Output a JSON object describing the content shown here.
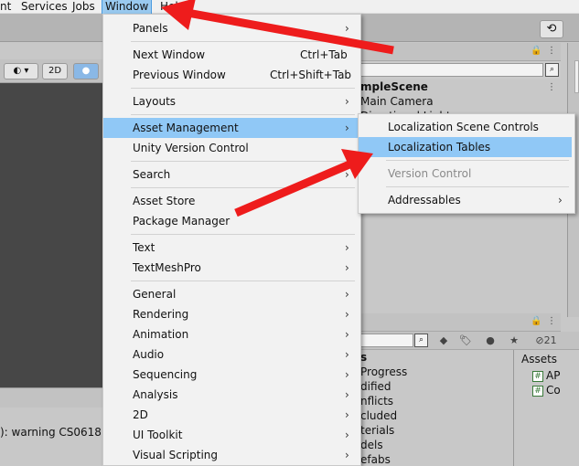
{
  "menubar": {
    "items": [
      "nt",
      "Services",
      "Jobs",
      "Window",
      "Help"
    ]
  },
  "toolbar": {
    "history_icon": "history-icon",
    "scene_buttons": {
      "mode": "2D"
    }
  },
  "hierarchy": {
    "title_fragment": "mpleScene",
    "rows": [
      "Main Camera",
      "Directional Light"
    ]
  },
  "project": {
    "folders": [
      "s",
      "Progress",
      "dified",
      "nflicts",
      "cluded",
      "terials",
      "dels",
      "efabs"
    ],
    "assets_title": "Assets",
    "assets": [
      "AP",
      "Co"
    ],
    "hidden_count": "21"
  },
  "console": {
    "message": "): warning CS0618:"
  },
  "window_menu": {
    "items": [
      {
        "label": "Panels",
        "submenu": true
      },
      {
        "label": "Next Window",
        "shortcut": "Ctrl+Tab"
      },
      {
        "label": "Previous Window",
        "shortcut": "Ctrl+Shift+Tab"
      },
      {
        "label": "Layouts",
        "submenu": true
      },
      {
        "label": "Asset Management",
        "submenu": true,
        "highlighted": true
      },
      {
        "label": "Unity Version Control"
      },
      {
        "label": "Search",
        "submenu": true
      },
      {
        "label": "Asset Store"
      },
      {
        "label": "Package Manager"
      },
      {
        "label": "Text",
        "submenu": true
      },
      {
        "label": "TextMeshPro",
        "submenu": true
      },
      {
        "label": "General",
        "submenu": true
      },
      {
        "label": "Rendering",
        "submenu": true
      },
      {
        "label": "Animation",
        "submenu": true
      },
      {
        "label": "Audio",
        "submenu": true
      },
      {
        "label": "Sequencing",
        "submenu": true
      },
      {
        "label": "Analysis",
        "submenu": true
      },
      {
        "label": "2D",
        "submenu": true
      },
      {
        "label": "UI Toolkit",
        "submenu": true
      },
      {
        "label": "Visual Scripting",
        "submenu": true
      }
    ]
  },
  "asset_submenu": {
    "items": [
      {
        "label": "Localization Scene Controls"
      },
      {
        "label": "Localization Tables",
        "highlighted": true
      },
      {
        "label": "Version Control",
        "disabled": true
      },
      {
        "label": "Addressables",
        "submenu": true
      }
    ]
  },
  "colors": {
    "highlight": "#90c8f6",
    "arrow": "#ee1c1c",
    "scene_bg": "#474747"
  }
}
